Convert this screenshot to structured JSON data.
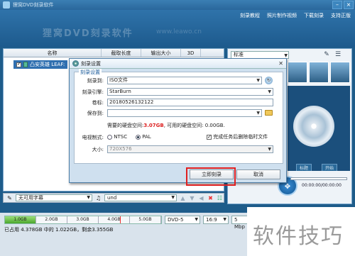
{
  "app": {
    "title": "狸窝DVD刻录软件",
    "top_links": [
      "刻录教程",
      "照片制作视频",
      "下载刻录",
      "支持正版"
    ],
    "banner_logo": "狸窝DVD刻录软件",
    "banner_url": "www.leawo.cn"
  },
  "file_list": {
    "columns": [
      "名称",
      "截取长度",
      "输出大小",
      "3D"
    ],
    "rows": [
      {
        "checked": true,
        "title": "凸安英雄 LEAF:"
      }
    ]
  },
  "right_panel": {
    "template_select": "标准",
    "tabs": [
      "标题",
      "开始"
    ],
    "time": "00:00:00/00:00:00"
  },
  "subtitle_row": {
    "subtitle_value": "无可用字幕",
    "audio_value": "und"
  },
  "capacity": {
    "segments": [
      "1.0GB",
      "2.0GB",
      "3.0GB",
      "4.0GB",
      "5.0GB"
    ],
    "used_fraction": 0.2,
    "status_text": "已占用 4.378GB 中的 1.022GB，剩余3.355GB"
  },
  "output": {
    "format": "DVD-5",
    "aspect": "16:9",
    "bitrate": "5 Mbp"
  },
  "dialog": {
    "title": "刻录设置",
    "group_label": "刻录设置",
    "burn_to_label": "刻录到:",
    "burn_to_value": "ISO文件",
    "engine_label": "刻录引擎:",
    "engine_value": "StarBurn",
    "volume_label": "卷标:",
    "volume_value": "20180526132122",
    "save_label": "保存到:",
    "save_value": "",
    "space_prefix": "需要的硬盘空间:",
    "space_required": "3.07GB",
    "space_suffix": ", 可用的硬盘空间: 0.00GB.",
    "tv_label": "电视制式:",
    "tv_options": [
      "NTSC",
      "PAL"
    ],
    "tv_selected": "PAL",
    "delete_after_label": "完成任务后删除临时文件",
    "delete_after_checked": true,
    "size_label": "大小:",
    "size_value": "720X576",
    "burn_button": "立即刻录",
    "cancel_button": "取消"
  },
  "watermark": "软件技巧",
  "colors": {
    "accent": "#2f73aa",
    "warning": "#d22222",
    "highlight": "#e02020",
    "capacity_fill": "#4aa62c"
  }
}
